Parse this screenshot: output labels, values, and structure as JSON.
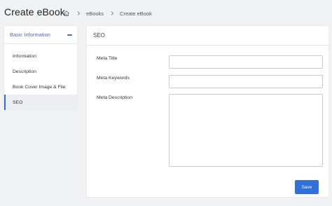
{
  "header": {
    "title": "Create eBook",
    "breadcrumb": [
      "eBooks",
      "Create eBook"
    ]
  },
  "sidebar": {
    "section_title": "Basic Information",
    "items": [
      {
        "label": "Information"
      },
      {
        "label": "Description"
      },
      {
        "label": "Book Cover Image & File"
      },
      {
        "label": "SEO"
      }
    ],
    "active_index": 3
  },
  "main": {
    "section_title": "SEO",
    "fields": [
      {
        "label": "Meta Title",
        "value": ""
      },
      {
        "label": "Meta Keywords",
        "value": ""
      },
      {
        "label": "Meta Description",
        "value": ""
      }
    ],
    "save_label": "Save"
  },
  "colors": {
    "accent": "#5065c9",
    "primary_button": "#2f6fde",
    "active_border": "#2d6be4",
    "background": "#f1f2f4"
  },
  "icons": {
    "home": "home-icon",
    "separator": "chevron-right-icon",
    "collapse": "minus-icon"
  }
}
